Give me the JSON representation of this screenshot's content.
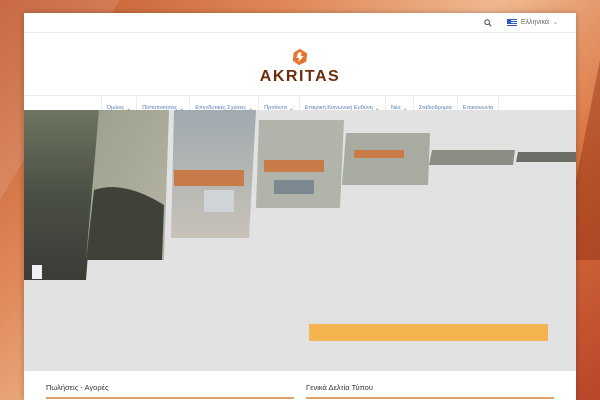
{
  "header": {
    "search_icon": "search-icon",
    "language_label": "Ελληνικά",
    "language_flag": "greek-flag-icon"
  },
  "logo": {
    "text": "AKRITAS",
    "accent_color": "#e8742a",
    "text_color": "#6a2e0e"
  },
  "nav": {
    "items": [
      {
        "label": "Όμιλος",
        "has_dropdown": true
      },
      {
        "label": "Πιστοποιήσεις",
        "has_dropdown": true
      },
      {
        "label": "Επενδυτικές Σχέσεις",
        "has_dropdown": true
      },
      {
        "label": "Προϊόντα",
        "has_dropdown": true
      },
      {
        "label": "Εταιρική Κοινωνική Ευθύνη",
        "has_dropdown": true
      },
      {
        "label": "Νέα",
        "has_dropdown": true
      },
      {
        "label": "Σταδιοδρομία",
        "has_dropdown": false
      },
      {
        "label": "Επικοινωνία",
        "has_dropdown": false
      }
    ],
    "link_color": "#5a7fb5"
  },
  "hero": {
    "image": "aerial-factory-photo",
    "bar_color": "#f4b550"
  },
  "sections": {
    "left_heading": "Πωλήσεις - Αγορές",
    "right_heading": "Γενικά Δελτία Τύπου"
  }
}
